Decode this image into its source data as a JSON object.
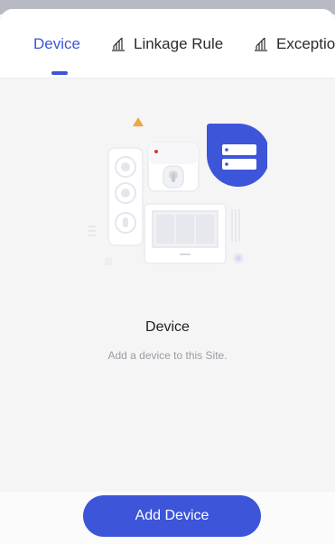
{
  "tabs": [
    {
      "label": "Device",
      "active": true,
      "icon": null
    },
    {
      "label": "Linkage Rule",
      "active": false,
      "icon": "signal-bars-icon"
    },
    {
      "label": "Exceptio",
      "active": false,
      "icon": "signal-bars-icon"
    }
  ],
  "empty_state": {
    "title": "Device",
    "subtitle": "Add a device to this Site.",
    "illustration": "device-group-illustration"
  },
  "actions": {
    "add_device_label": "Add Device"
  },
  "colors": {
    "accent": "#3c55d9",
    "warning_triangle": "#f2a541",
    "background": "#f5f5f6"
  }
}
